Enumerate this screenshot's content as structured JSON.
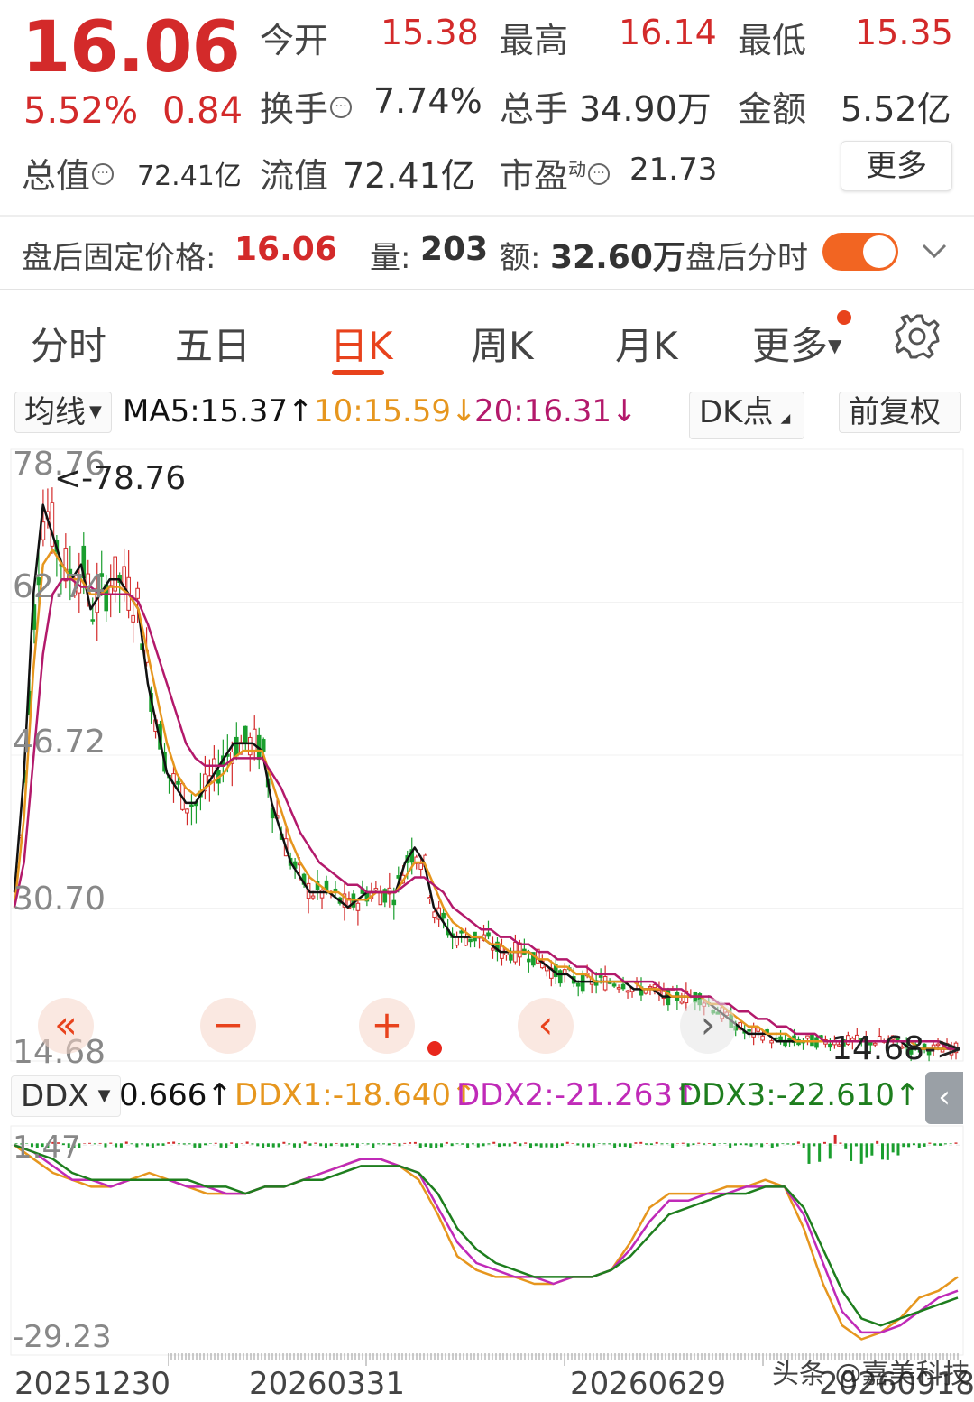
{
  "quote": {
    "price": "16.06",
    "change_pct": "5.52%",
    "change": "0.84",
    "open_label": "今开",
    "open_value": "15.38",
    "high_label": "最高",
    "high_value": "16.14",
    "low_label": "最低",
    "low_value": "15.35",
    "turnover_label": "换手",
    "turnover_value": "7.74%",
    "volume_label": "总手",
    "volume_value": "34.90万",
    "amount_label": "金额",
    "amount_value": "5.52亿",
    "total_cap_label": "总值",
    "total_cap_value": "72.41亿",
    "float_cap_label": "流值",
    "float_cap_value": "72.41亿",
    "pe_label": "市盈",
    "pe_sup": "动",
    "pe_value": "21.73",
    "more_label": "更多",
    "info_icon": "···"
  },
  "after_hours": {
    "price_label": "盘后固定价格:",
    "price_value": "16.06",
    "vol_label": "量:",
    "vol_value": "203",
    "amt_label": "额:",
    "amt_value": "32.60万",
    "timeshare_label": "盘后分时",
    "toggle_on": true,
    "expand_icon": "chevron-down-icon"
  },
  "tabs": [
    {
      "label": "分时"
    },
    {
      "label": "五日"
    },
    {
      "label": "日K"
    },
    {
      "label": "周K"
    },
    {
      "label": "月K"
    },
    {
      "label": "更多"
    }
  ],
  "active_tab": "日K",
  "settings_icon": "gear-icon",
  "indicator_bar": {
    "ma_selector": "均线",
    "ma5": "MA5:15.37",
    "ma10": "10:15.59",
    "ma20": "20:16.31",
    "up_arrow": "↑",
    "down_arrow": "↓",
    "dk_label": "DK点",
    "adjust_label": "前复权"
  },
  "colors": {
    "up": "#d32a2a",
    "down": "#1a9e2e",
    "ma5": "#111111",
    "ma10": "#e6961e",
    "ma20": "#b3196b",
    "ddx": "#e6961e",
    "ddx2": "#c02ab8",
    "ddx3": "#1e7e1e",
    "accent": "#e8421c"
  },
  "price_chart": {
    "y_labels": [
      "78.76",
      "62.74",
      "46.72",
      "30.70",
      "14.68"
    ],
    "max_marker": "<-78.76",
    "min_marker": "14.68->",
    "nav_buttons": [
      "«",
      "−",
      "+",
      "‹",
      "›"
    ]
  },
  "ddx_bar": {
    "selector": "DDX",
    "ddx": "0.666↑",
    "ddx1": "DDX1:-18.640↑",
    "ddx2": "DDX2:-21.263↑",
    "ddx3": "DDX3:-22.610↑",
    "collapse": "‹"
  },
  "ddx_chart": {
    "y_top": "1.47",
    "y_bottom": "-29.23"
  },
  "dates": [
    "20251230",
    "20260331",
    "20260629",
    "20260918"
  ],
  "watermark": "头条 @嘉美科技",
  "chart_data": [
    {
      "type": "candlestick",
      "title": "",
      "ylim": [
        14.68,
        78.76
      ],
      "x_start": "20251230",
      "x_end": "20260918",
      "series": [
        {
          "name": "MA5",
          "values": [
            22,
            38,
            62,
            74,
            70,
            66,
            64,
            66,
            60,
            62,
            64,
            64,
            62,
            60,
            50,
            44,
            38,
            36,
            34,
            34,
            36,
            38,
            40,
            42,
            42,
            42,
            41,
            34,
            30,
            26,
            24,
            22,
            22,
            22,
            21,
            20,
            21,
            22,
            22,
            22,
            22,
            26,
            28,
            26,
            20,
            18,
            16,
            16,
            16,
            16,
            15,
            14,
            14,
            14,
            14,
            13,
            12,
            11,
            11,
            10,
            10,
            10,
            10,
            10,
            10,
            9,
            9,
            9,
            8,
            8,
            8,
            8,
            8,
            7,
            6,
            5,
            4,
            3,
            3,
            3,
            2,
            2,
            2,
            2,
            2,
            2,
            2,
            2,
            2,
            2,
            2,
            2,
            2,
            2,
            1,
            1,
            1,
            1,
            1,
            1
          ]
        },
        {
          "name": "MA10",
          "values": [
            20,
            32,
            52,
            66,
            68,
            66,
            64,
            64,
            62,
            62,
            63,
            63,
            62,
            60,
            54,
            48,
            42,
            38,
            36,
            35,
            36,
            37,
            38,
            40,
            41,
            41,
            41,
            37,
            33,
            29,
            26,
            24,
            23,
            22,
            22,
            21,
            21,
            21,
            22,
            22,
            22,
            24,
            26,
            26,
            23,
            20,
            18,
            17,
            16,
            16,
            15,
            15,
            14,
            14,
            14,
            13,
            13,
            12,
            12,
            11,
            11,
            10,
            10,
            10,
            10,
            10,
            9,
            9,
            9,
            8,
            8,
            8,
            8,
            7,
            7,
            6,
            5,
            4,
            4,
            3,
            3,
            3,
            2,
            2,
            2,
            2,
            2,
            2,
            2,
            2,
            2,
            2,
            2,
            2,
            2,
            1,
            1,
            1,
            1,
            1
          ]
        },
        {
          "name": "MA20",
          "values": [
            20,
            26,
            40,
            54,
            62,
            64,
            64,
            63,
            63,
            62,
            62,
            62,
            62,
            61,
            58,
            54,
            50,
            46,
            42,
            40,
            39,
            39,
            39,
            40,
            40,
            40,
            40,
            38,
            36,
            33,
            30,
            28,
            26,
            25,
            24,
            23,
            23,
            22,
            22,
            22,
            22,
            23,
            24,
            24,
            23,
            22,
            20,
            19,
            18,
            17,
            17,
            16,
            16,
            15,
            15,
            14,
            14,
            13,
            13,
            12,
            12,
            11,
            11,
            11,
            10,
            10,
            10,
            10,
            9,
            9,
            9,
            8,
            8,
            8,
            7,
            7,
            6,
            6,
            5,
            5,
            4,
            4,
            3,
            3,
            3,
            2,
            2,
            2,
            2,
            2,
            2,
            2,
            2,
            2,
            2,
            2,
            2,
            2,
            1,
            1
          ]
        }
      ],
      "price_max": 78.76,
      "price_min": 14.68,
      "last_close": 16.06
    },
    {
      "type": "line",
      "title": "",
      "ylim": [
        -29.23,
        1.47
      ],
      "series": [
        {
          "name": "DDX1",
          "values": [
            0,
            -2,
            -4,
            -5,
            -6,
            -6,
            -5,
            -4,
            -5,
            -6,
            -7,
            -7,
            -7,
            -6,
            -6,
            -5,
            -4,
            -3,
            -2,
            -2,
            -3,
            -5,
            -10,
            -16,
            -18,
            -19,
            -19,
            -20,
            -20,
            -19,
            -19,
            -18,
            -14,
            -9,
            -7,
            -7,
            -7,
            -6,
            -6,
            -5,
            -6,
            -12,
            -20,
            -26,
            -28,
            -27,
            -25,
            -22,
            -21,
            -19
          ]
        },
        {
          "name": "DDX2",
          "values": [
            0,
            -1,
            -3,
            -5,
            -5,
            -6,
            -5,
            -5,
            -5,
            -6,
            -6,
            -7,
            -7,
            -6,
            -6,
            -5,
            -4,
            -3,
            -2,
            -2,
            -3,
            -4,
            -9,
            -14,
            -17,
            -18,
            -19,
            -19,
            -20,
            -19,
            -19,
            -18,
            -15,
            -11,
            -8,
            -8,
            -7,
            -7,
            -6,
            -6,
            -6,
            -10,
            -17,
            -24,
            -27,
            -27,
            -26,
            -24,
            -22,
            -21
          ]
        },
        {
          "name": "DDX3",
          "values": [
            0,
            -1,
            -2,
            -4,
            -5,
            -5,
            -5,
            -5,
            -5,
            -5,
            -6,
            -6,
            -7,
            -6,
            -6,
            -5,
            -5,
            -4,
            -3,
            -3,
            -3,
            -4,
            -7,
            -12,
            -15,
            -17,
            -18,
            -19,
            -19,
            -19,
            -19,
            -18,
            -16,
            -13,
            -10,
            -9,
            -8,
            -7,
            -7,
            -6,
            -6,
            -9,
            -15,
            -21,
            -25,
            -26,
            -25,
            -24,
            -23,
            -22
          ]
        }
      ]
    }
  ]
}
